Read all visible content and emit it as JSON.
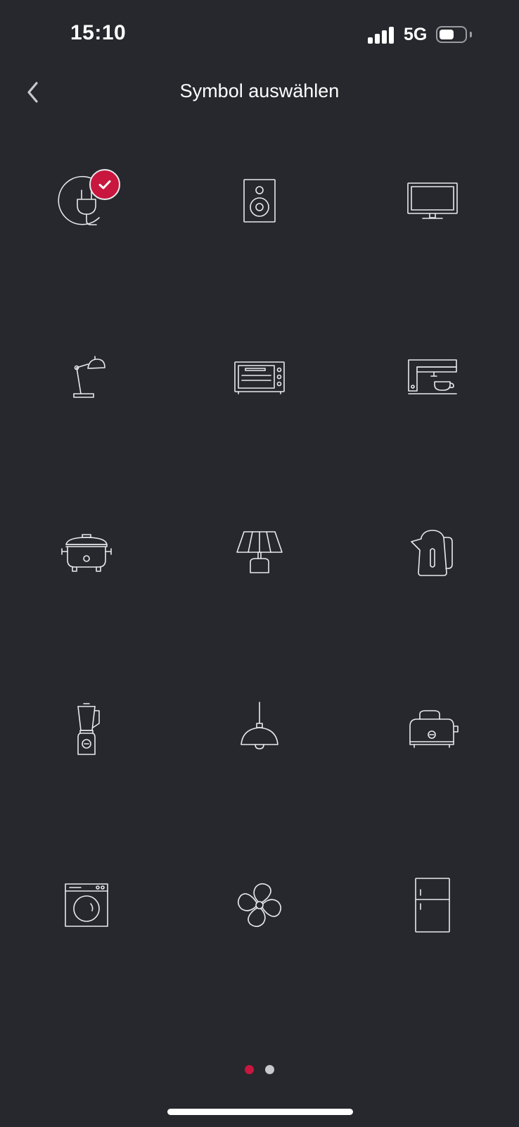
{
  "status_bar": {
    "time": "15:10",
    "network": "5G"
  },
  "header": {
    "title": "Symbol auswählen",
    "back_icon": "chevron-left-icon"
  },
  "icons": [
    {
      "name": "plug-icon",
      "selected": true
    },
    {
      "name": "speaker-icon",
      "selected": false
    },
    {
      "name": "tv-icon",
      "selected": false
    },
    {
      "name": "desk-lamp-icon",
      "selected": false
    },
    {
      "name": "oven-icon",
      "selected": false
    },
    {
      "name": "coffee-machine-icon",
      "selected": false
    },
    {
      "name": "rice-cooker-icon",
      "selected": false
    },
    {
      "name": "table-lamp-icon",
      "selected": false
    },
    {
      "name": "kettle-icon",
      "selected": false
    },
    {
      "name": "blender-icon",
      "selected": false
    },
    {
      "name": "pendant-lamp-icon",
      "selected": false
    },
    {
      "name": "toaster-icon",
      "selected": false
    },
    {
      "name": "washing-machine-icon",
      "selected": false
    },
    {
      "name": "fan-icon",
      "selected": false
    },
    {
      "name": "fridge-icon",
      "selected": false
    }
  ],
  "pager": {
    "total": 2,
    "current": 1
  },
  "colors": {
    "background": "#26282d",
    "accent": "#c8163f",
    "icon": "#e9e9ec",
    "dot_inactive": "#c8c9cc"
  }
}
